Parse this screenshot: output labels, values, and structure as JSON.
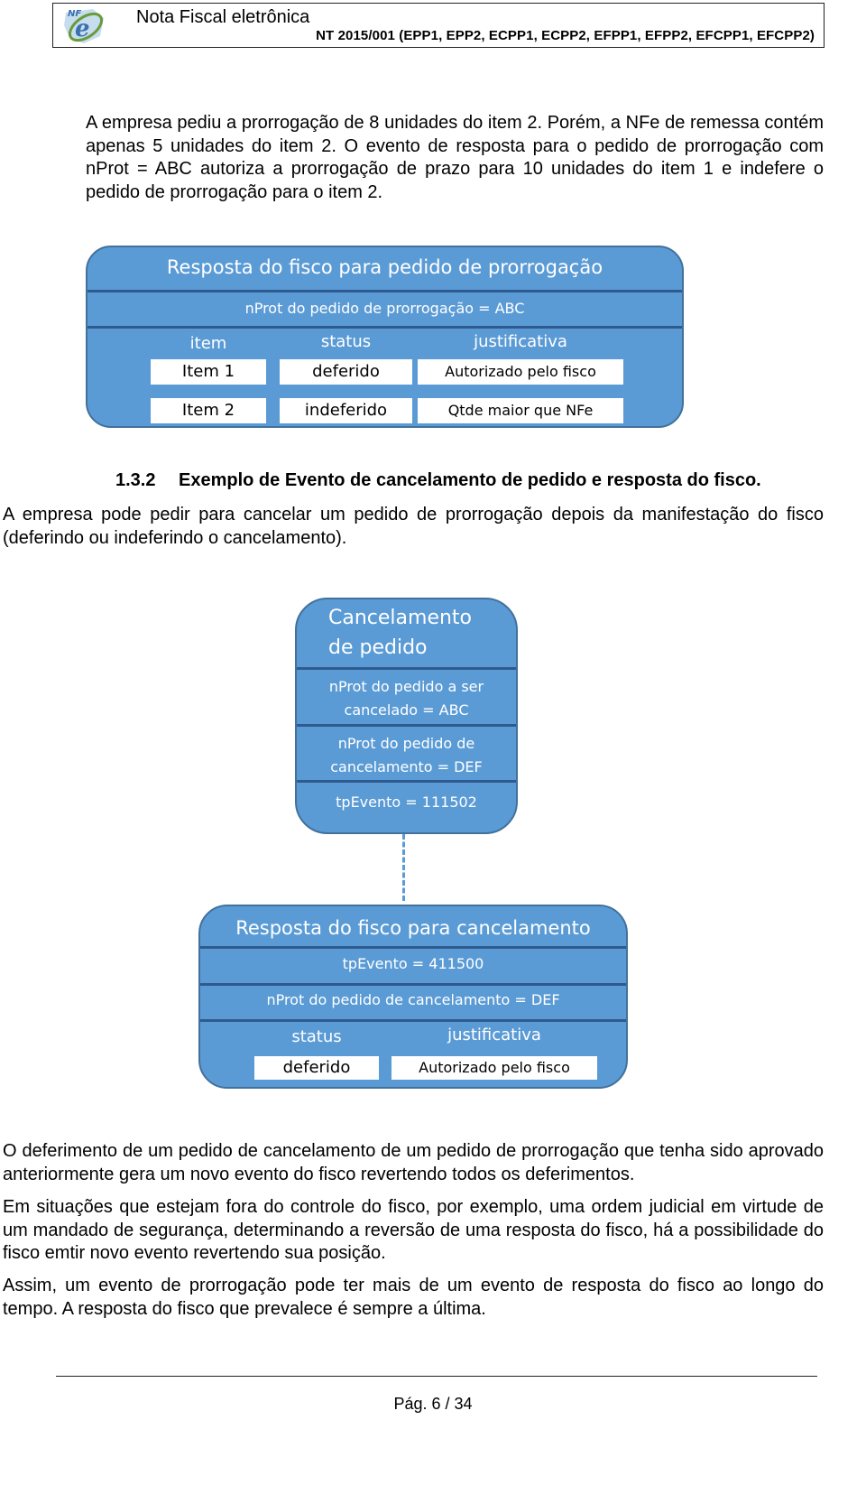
{
  "header": {
    "logo_icon": "nfe-logo-icon",
    "title": "Nota Fiscal eletrônica",
    "subtitle": "NT 2015/001 (EPP1, EPP2, ECPP1, ECPP2, EFPP1, EFPP2, EFCPP1, EFCPP2)"
  },
  "intro_paragraph": "A empresa pediu a prorrogação de 8 unidades do item 2. Porém, a NFe de remessa contém apenas 5 unidades do item 2. O evento de resposta para o pedido de prorrogação com  nProt = ABC autoriza a prorrogação de prazo para 10 unidades do item 1 e indefere o pedido de prorrogação para o item 2.",
  "diagram1": {
    "title": "Resposta do fisco para pedido de prorrogação",
    "nprot": "nProt do pedido de prorrogação = ABC",
    "columns": [
      "item",
      "status",
      "justificativa"
    ],
    "rows": [
      [
        "Item 1",
        "deferido",
        "Autorizado pelo fisco"
      ],
      [
        "Item 2",
        "indeferido",
        "Qtde maior que NFe"
      ]
    ]
  },
  "section": {
    "number": "1.3.2",
    "title": "Exemplo de Evento de cancelamento de pedido e resposta do fisco.",
    "paragraph": "A empresa pode pedir para cancelar um pedido de prorrogação depois da manifestação do fisco (deferindo ou indeferindo o cancelamento)."
  },
  "diagram2": {
    "title_line1": "Cancelamento",
    "title_line2": "de pedido",
    "nprot_cancel_line1": "nProt do pedido a ser",
    "nprot_cancel_line2": "cancelado = ABC",
    "nprot_req_line1": "nProt do pedido de",
    "nprot_req_line2": "cancelamento = DEF",
    "tpevento": "tpEvento = 111502"
  },
  "diagram3": {
    "title": "Resposta do fisco para cancelamento",
    "tpevento": "tpEvento = 411500",
    "nprot": "nProt do pedido de cancelamento = DEF",
    "columns": [
      "status",
      "justificativa"
    ],
    "row": [
      "deferido",
      "Autorizado pelo fisco"
    ]
  },
  "closing_paragraphs": [
    "O deferimento de um pedido de cancelamento de um pedido de prorrogação que tenha sido aprovado anteriormente gera um novo evento do fisco revertendo todos os deferimentos.",
    "Em situações que estejam fora do controle do fisco, por exemplo, uma ordem judicial em virtude de um mandado de segurança, determinando a reversão de uma resposta do fisco, há a possibilidade do fisco emtir novo evento revertendo sua posição.",
    "Assim, um evento de prorrogação pode ter mais de um evento de resposta do fisco ao longo do tempo. A resposta do fisco que prevalece é sempre a última."
  ],
  "footer": {
    "page": "Pág. 6 / 34"
  },
  "colors": {
    "diagram_fill": "#5b9bd5",
    "diagram_border": "#41719c",
    "separator": "#2e5a8f"
  }
}
